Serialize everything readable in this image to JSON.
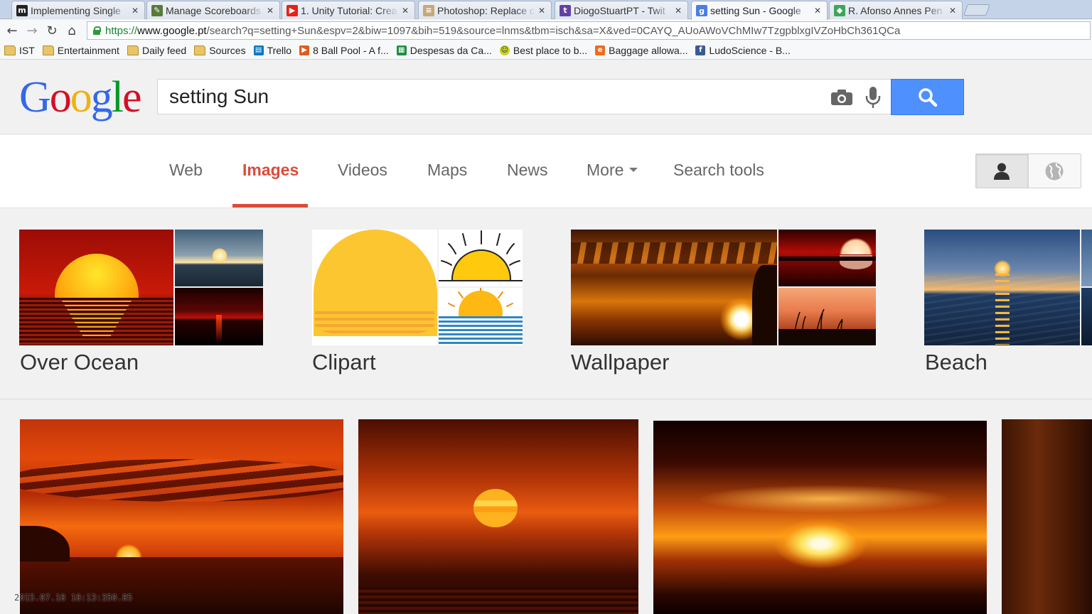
{
  "browser": {
    "tabs": [
      {
        "title": "Implementing Single",
        "icon": "medium-icon",
        "active": false
      },
      {
        "title": "Manage Scoreboards",
        "icon": "pen-icon",
        "active": false
      },
      {
        "title": "1. Unity Tutorial: Crea",
        "icon": "youtube-icon",
        "active": false
      },
      {
        "title": "Photoshop: Replace c",
        "icon": "stackexchange-icon",
        "active": false
      },
      {
        "title": "DiogoStuartPT - Twit",
        "icon": "twitch-icon",
        "active": false
      },
      {
        "title": "setting Sun - Google",
        "icon": "google-icon",
        "active": true
      },
      {
        "title": "R. Afonso Annes Pen",
        "icon": "maps-icon",
        "active": false
      }
    ],
    "url": {
      "scheme": "https://",
      "host": "www.google.pt",
      "path": "/search?q=setting+Sun&espv=2&biw=1097&bih=519&source=lnms&tbm=isch&sa=X&ved=0CAYQ_AUoAWoVChMIw7TzgpblxgIVZoHbCh361QCa"
    },
    "bookmarks": [
      {
        "label": "IST",
        "icon": "folder-icon"
      },
      {
        "label": "Entertainment",
        "icon": "folder-icon"
      },
      {
        "label": "Daily feed",
        "icon": "folder-icon"
      },
      {
        "label": "Sources",
        "icon": "folder-icon"
      },
      {
        "label": "Trello",
        "icon": "trello-icon"
      },
      {
        "label": "8 Ball Pool - A f...",
        "icon": "play-icon"
      },
      {
        "label": "Despesas da Ca...",
        "icon": "sheets-icon"
      },
      {
        "label": "Best place to b...",
        "icon": "smiley-icon"
      },
      {
        "label": "Baggage allowa...",
        "icon": "orange-e-icon"
      },
      {
        "label": "LudoScience - B...",
        "icon": "facebook-icon"
      }
    ]
  },
  "google": {
    "logo_letters": [
      "G",
      "o",
      "o",
      "g",
      "l",
      "e"
    ],
    "logo_colors": [
      "#3369e8",
      "#d50f25",
      "#eeb211",
      "#3369e8",
      "#009925",
      "#d50f25"
    ],
    "query": "setting Sun",
    "accent_color": "#dd4b39",
    "search_button_color": "#4d90fe"
  },
  "nav": {
    "items": [
      "Web",
      "Images",
      "Videos",
      "Maps",
      "News",
      "More",
      "Search tools"
    ],
    "active": "Images"
  },
  "related": [
    {
      "label": "Over Ocean"
    },
    {
      "label": "Clipart"
    },
    {
      "label": "Wallpaper"
    },
    {
      "label": "Beach"
    }
  ],
  "overlay": {
    "timestamp": "2015.07.18 18:13:350.85"
  }
}
